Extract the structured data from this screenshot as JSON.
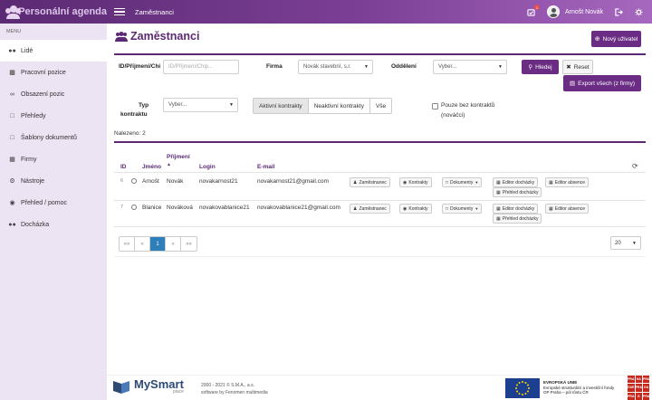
{
  "app": {
    "title": "Personální agenda",
    "breadcrumb": "Zaměstnanci",
    "user_name": "Arnošt Novák",
    "notification_count": "1"
  },
  "sidebar": {
    "menu_label": "MENU",
    "items": [
      {
        "label": "Lidé",
        "icon": "users-icon"
      },
      {
        "label": "Pracovní pozice",
        "icon": "briefcase-icon"
      },
      {
        "label": "Obsazení pozic",
        "icon": "link-icon"
      },
      {
        "label": "Přehledy",
        "icon": "file-icon"
      },
      {
        "label": "Šablony dokumentů",
        "icon": "file-icon"
      },
      {
        "label": "Firmy",
        "icon": "building-icon"
      },
      {
        "label": "Nástroje",
        "icon": "gears-icon"
      },
      {
        "label": "Přehled / pomoc",
        "icon": "globe-icon"
      },
      {
        "label": "Docházka",
        "icon": "users-icon"
      }
    ]
  },
  "page": {
    "title": "Zaměstnanci",
    "new_user_button": "Nový uživatel"
  },
  "filters": {
    "id_label": "ID/Příjmení/Chi",
    "id_placeholder": "ID/Příjmení/Chip...",
    "firma_label": "Firma",
    "firma_value": "Novák stavební, s.r.",
    "oddeleni_label": "Oddělení",
    "oddeleni_value": "Vyber...",
    "search_button": "Hledej",
    "reset_button": "Reset",
    "export_button": "Export všech (z firmy)",
    "typ_label_1": "Typ",
    "typ_label_2": "kontraktu",
    "typ_value": "Vyber...",
    "contract_tabs": [
      "Aktivní kontrakty",
      "Neaktivní kontrakty",
      "Vše"
    ],
    "only_without_label_1": "Pouze bez kontraktů",
    "only_without_label_2": "(nováčci)"
  },
  "results": {
    "found_text": "Nalezeno: 2"
  },
  "table": {
    "headers": {
      "id": "ID",
      "jmeno": "Jméno",
      "prijmeni": "Příjmení",
      "login": "Login",
      "email": "E-mail"
    },
    "rows": [
      {
        "id": "6",
        "jmeno": "Arnošt",
        "prijmeni": "Novák",
        "login": "novakarnost21",
        "email": "novakarnost21@gmail.com"
      },
      {
        "id": "7",
        "jmeno": "Blanice",
        "prijmeni": "Nováková",
        "login": "novakovablanice21",
        "email": "novakovablanice21@gmail.com"
      }
    ],
    "actions": {
      "zamestnanec": "Zaměstnanec",
      "kontrakty": "Kontrakty",
      "dokumenty": "Dokumenty",
      "editor_dochazky": "Editor docházky",
      "editor_absence": "Editor absence",
      "prehled_dochazky": "Přehled docházky"
    }
  },
  "pagination": {
    "first": "««",
    "prev": "«",
    "current": "1",
    "next": "»",
    "last": "»»",
    "per_page": "20"
  },
  "footer": {
    "logo_main": "MySmart",
    "logo_sub": "place",
    "copyright": "2000 - 2021 © S.M.A., a.s.",
    "software_by": "software by Fenomen multimedia",
    "eu_title": "EVROPSKÁ UNIE",
    "eu_line2": "Evropské strukturální a investiční fondy",
    "eu_line3": "OP Praha – pól růstu ČR",
    "praha_letters": [
      "PRA",
      "HA",
      "PRA",
      "GUE",
      "PRA",
      "GA",
      "PRA",
      "G",
      "PRA"
    ]
  }
}
